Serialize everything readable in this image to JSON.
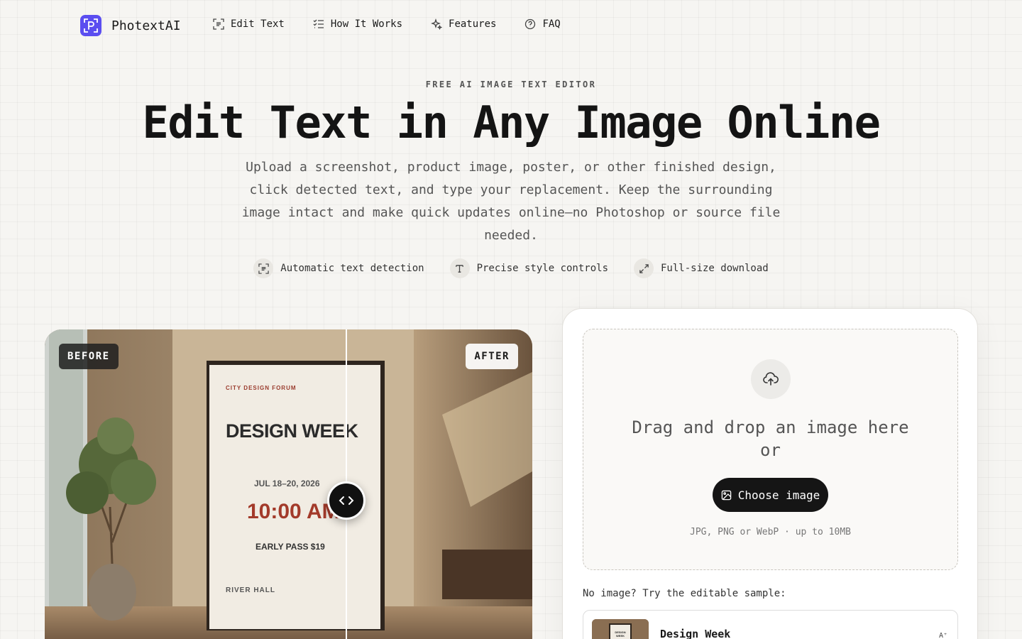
{
  "brand": {
    "name": "PhotextAI",
    "accent": "#5b4ef0"
  },
  "nav": {
    "links": [
      {
        "label": "Edit Text",
        "icon": "text-scan-icon"
      },
      {
        "label": "How It Works",
        "icon": "list-check-icon"
      },
      {
        "label": "Features",
        "icon": "sparkles-icon"
      },
      {
        "label": "FAQ",
        "icon": "help-circle-icon"
      }
    ]
  },
  "hero": {
    "eyebrow": "FREE AI IMAGE TEXT EDITOR",
    "title": "Edit Text in Any Image Online",
    "subtitle": "Upload a screenshot, product image, poster, or other finished design, click detected text, and type your replacement. Keep the surrounding image intact and make quick updates online—no Photoshop or source file needed.",
    "features": [
      {
        "label": "Automatic text detection",
        "icon": "text-scan-icon"
      },
      {
        "label": "Precise style controls",
        "icon": "type-icon"
      },
      {
        "label": "Full-size download",
        "icon": "expand-icon"
      }
    ]
  },
  "compare": {
    "before_label": "BEFORE",
    "after_label": "AFTER",
    "poster": {
      "org": "CITY DESIGN FORUM",
      "title": "DESIGN WEEK",
      "dates": "JUL 18–20, 2026",
      "time": "10:00 AM",
      "price": "EARLY PASS $19",
      "venue": "RIVER HALL",
      "time_color": "#a33a2a"
    }
  },
  "upload": {
    "drop_line1": "Drag and drop an image here",
    "drop_line2": "or",
    "button_label": "Choose image",
    "formats": "JPG, PNG or WebP · up to 10MB",
    "sample_prompt": "No image? Try the editable sample:",
    "sample_title": "Design Week",
    "sample_thumb_text": "DESIGN WEEK",
    "sample_icon_text": "A⁺"
  }
}
